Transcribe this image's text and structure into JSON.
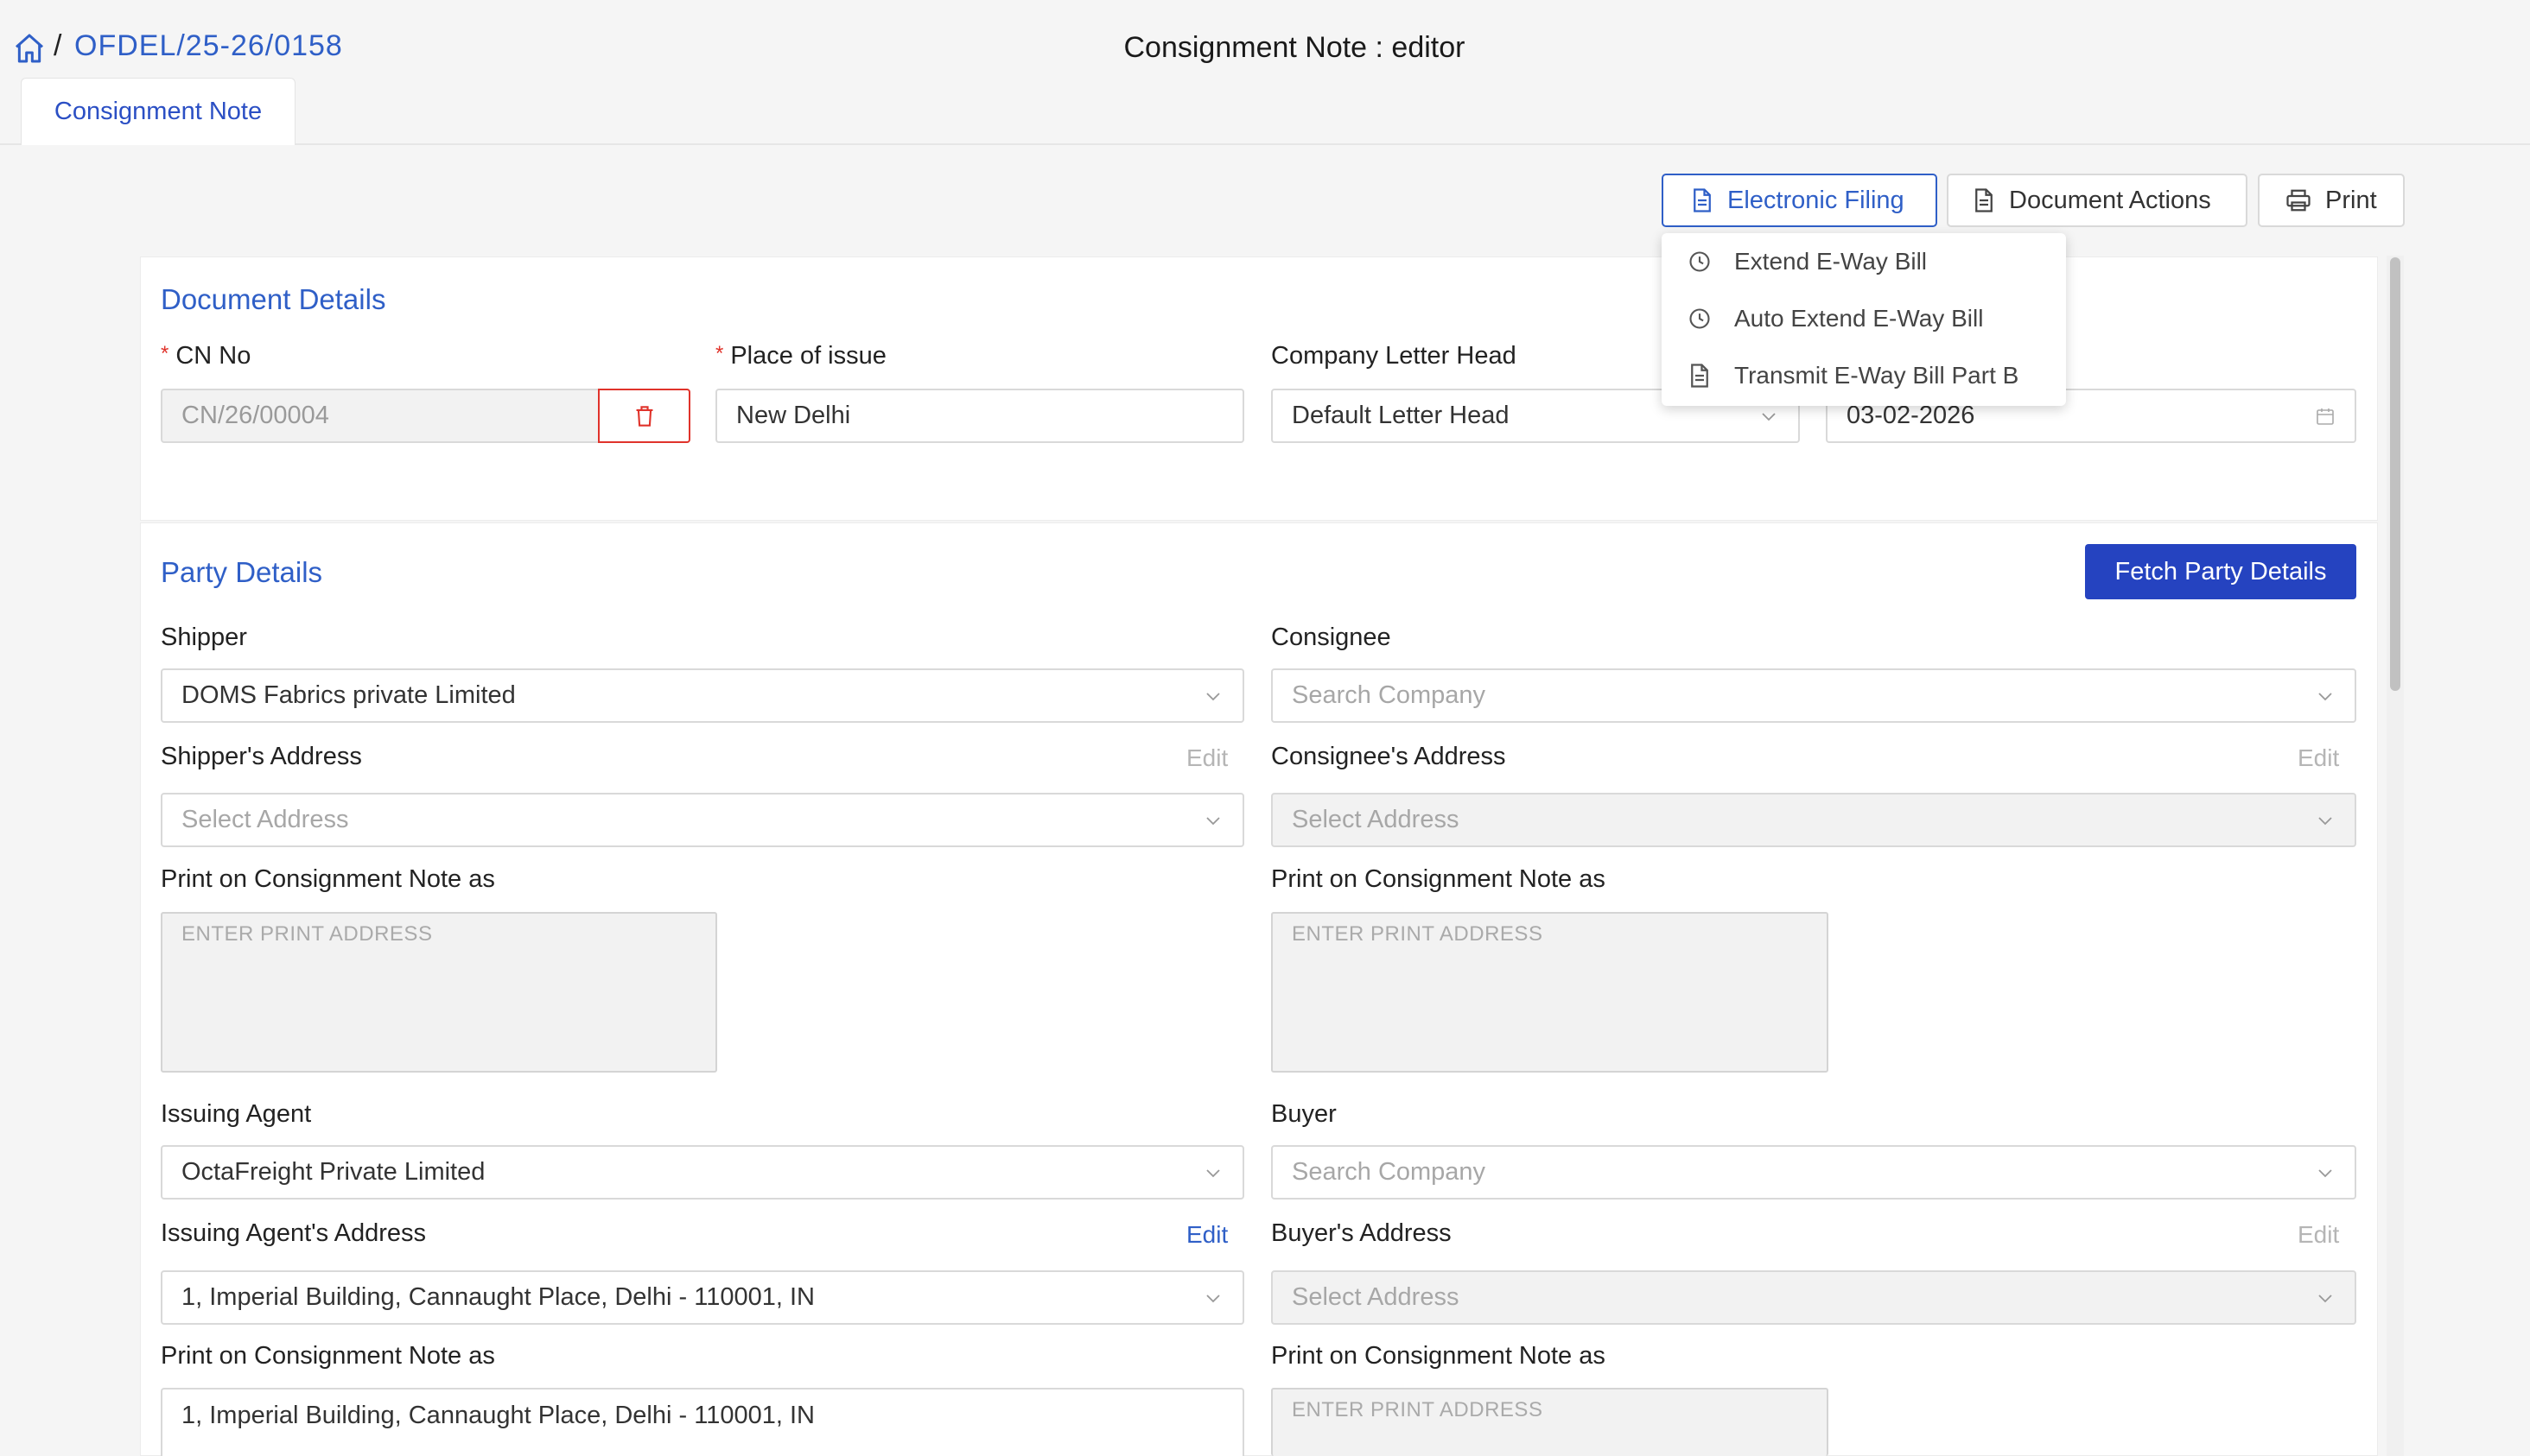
{
  "breadcrumb": {
    "separator": "/",
    "doc_number": "OFDEL/25-26/0158"
  },
  "page_title": "Consignment Note : editor",
  "tabs": [
    {
      "label": "Consignment Note"
    }
  ],
  "toolbar": {
    "electronic_filing": "Electronic Filing",
    "document_actions": "Document Actions",
    "print": "Print"
  },
  "efiling_menu": {
    "items": [
      {
        "label": "Extend E-Way Bill",
        "icon": "clock-icon"
      },
      {
        "label": "Auto Extend E-Way Bill",
        "icon": "clock-icon"
      },
      {
        "label": "Transmit E-Way Bill Part B",
        "icon": "document-icon"
      }
    ]
  },
  "document_details": {
    "title": "Document Details",
    "cn_no": {
      "label": "CN No",
      "value": "CN/26/00004"
    },
    "place_of_issue": {
      "label": "Place of issue",
      "value": "New Delhi"
    },
    "letter_head": {
      "label": "Company Letter Head",
      "value": "Default Letter Head"
    },
    "date": {
      "value": "03-02-2026"
    }
  },
  "party_details": {
    "title": "Party Details",
    "fetch_button": "Fetch Party Details",
    "shipper": {
      "label": "Shipper",
      "value": "DOMS Fabrics private Limited"
    },
    "consignee": {
      "label": "Consignee",
      "placeholder": "Search Company"
    },
    "shipper_address": {
      "label": "Shipper's Address",
      "edit": "Edit",
      "placeholder": "Select Address"
    },
    "consignee_address": {
      "label": "Consignee's Address",
      "edit": "Edit",
      "placeholder": "Select Address"
    },
    "shipper_print": {
      "label": "Print on Consignment Note as",
      "placeholder": "ENTER PRINT ADDRESS"
    },
    "consignee_print": {
      "label": "Print on Consignment Note as",
      "placeholder": "ENTER PRINT ADDRESS"
    },
    "issuing_agent": {
      "label": "Issuing Agent",
      "value": "OctaFreight Private Limited"
    },
    "buyer": {
      "label": "Buyer",
      "placeholder": "Search Company"
    },
    "issuing_agent_address": {
      "label": "Issuing Agent's Address",
      "edit": "Edit",
      "value": "1, Imperial Building, Cannaught Place, Delhi - 110001, IN"
    },
    "buyer_address": {
      "label": "Buyer's Address",
      "edit": "Edit",
      "placeholder": "Select Address"
    },
    "agent_print": {
      "label": "Print on Consignment Note as",
      "value": "1, Imperial Building, Cannaught Place, Delhi - 110001, IN"
    },
    "buyer_print": {
      "label": "Print on Consignment Note as",
      "placeholder": "ENTER PRINT ADDRESS"
    }
  },
  "colors": {
    "accent": "#2f5fc7",
    "primary_button": "#2543c0",
    "required": "#e0332b",
    "delete": "#e0332b"
  }
}
